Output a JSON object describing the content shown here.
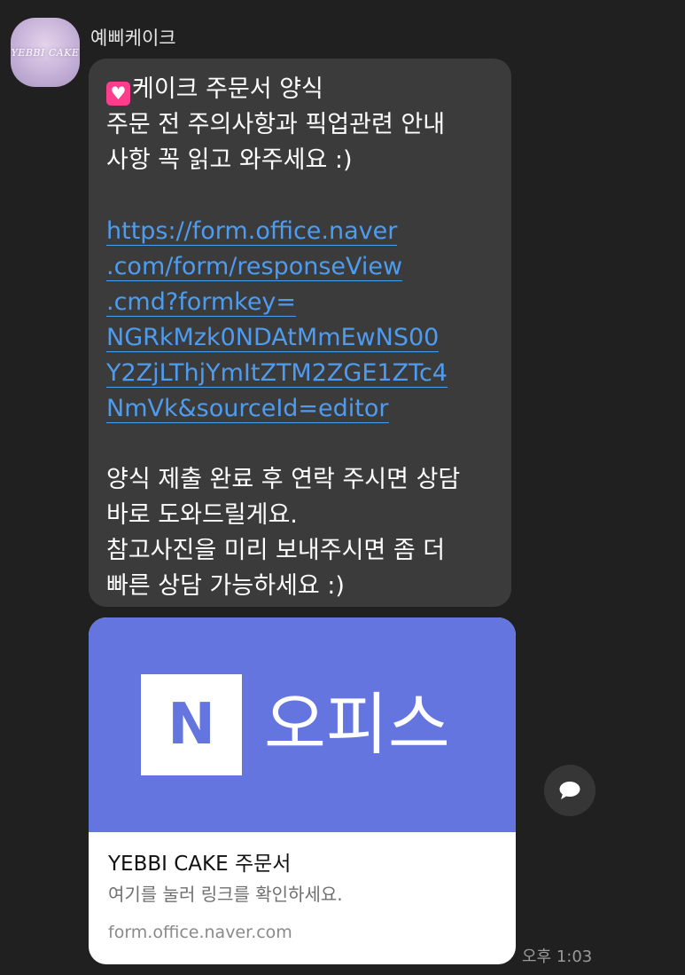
{
  "sender": {
    "name": "예삐케이크",
    "avatar_text": "YEBBI CAKE"
  },
  "message": {
    "heart_icon": "💗",
    "line1": "케이크 주문서 양식",
    "line2": "주문 전 주의사항과 픽업관련 안내",
    "line3": "사항 꼭 읽고 와주세요 :)",
    "link_lines": [
      "https://form.office.naver",
      ".com/form/responseView",
      ".cmd?formkey=",
      "NGRkMzk0NDAtMmEwNS00",
      "Y2ZjLThjYmItZTM2ZGE1ZTc4",
      "NmVk&sourceId=editor"
    ],
    "line4": "양식 제출 완료 후 연락 주시면 상담",
    "line5": "바로 도와드릴게요.",
    "line6": "참고사진을 미리 보내주시면 좀 더",
    "line7": "빠른 상담 가능하세요 :)"
  },
  "card": {
    "logo_letter": "N",
    "banner_text": "오피스",
    "title": "YEBBI CAKE 주문서",
    "description": "여기를 눌러 링크를 확인하세요.",
    "url": "form.office.naver.com",
    "colors": {
      "banner": "#6575e0"
    }
  },
  "share_icon": "speech-bubble-icon",
  "timestamp": "오후 1:03"
}
